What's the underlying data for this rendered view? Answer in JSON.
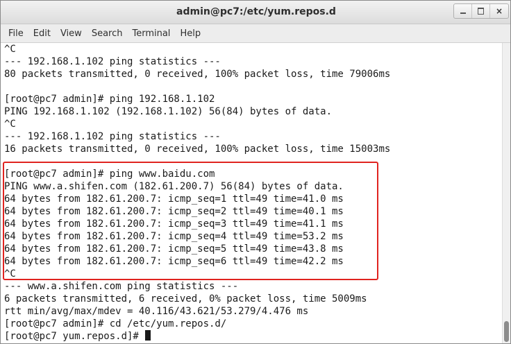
{
  "window": {
    "title": "admin@pc7:/etc/yum.repos.d",
    "buttons": {
      "minimize": "minimize",
      "maximize": "maximize",
      "close": "×"
    }
  },
  "menu": [
    "File",
    "Edit",
    "View",
    "Search",
    "Terminal",
    "Help"
  ],
  "terminal": {
    "lines": [
      "^C",
      "--- 192.168.1.102 ping statistics ---",
      "80 packets transmitted, 0 received, 100% packet loss, time 79006ms",
      "",
      "[root@pc7 admin]# ping 192.168.1.102",
      "PING 192.168.1.102 (192.168.1.102) 56(84) bytes of data.",
      "^C",
      "--- 192.168.1.102 ping statistics ---",
      "16 packets transmitted, 0 received, 100% packet loss, time 15003ms",
      "",
      "[root@pc7 admin]# ping www.baidu.com",
      "PING www.a.shifen.com (182.61.200.7) 56(84) bytes of data.",
      "64 bytes from 182.61.200.7: icmp_seq=1 ttl=49 time=41.0 ms",
      "64 bytes from 182.61.200.7: icmp_seq=2 ttl=49 time=40.1 ms",
      "64 bytes from 182.61.200.7: icmp_seq=3 ttl=49 time=41.1 ms",
      "64 bytes from 182.61.200.7: icmp_seq=4 ttl=49 time=53.2 ms",
      "64 bytes from 182.61.200.7: icmp_seq=5 ttl=49 time=43.8 ms",
      "64 bytes from 182.61.200.7: icmp_seq=6 ttl=49 time=42.2 ms",
      "^C",
      "--- www.a.shifen.com ping statistics ---",
      "6 packets transmitted, 6 received, 0% packet loss, time 5009ms",
      "rtt min/avg/max/mdev = 40.116/43.621/53.279/4.476 ms",
      "[root@pc7 admin]# cd /etc/yum.repos.d/",
      "[root@pc7 yum.repos.d]# "
    ]
  },
  "colors": {
    "highlight": "#e0231f",
    "text": "#1a1a1a",
    "background": "#ffffff"
  }
}
